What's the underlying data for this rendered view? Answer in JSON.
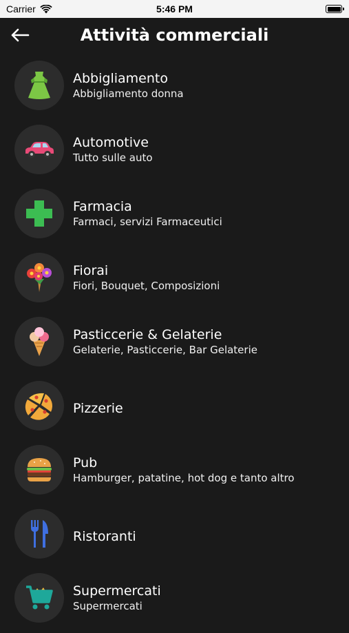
{
  "status": {
    "carrier": "Carrier",
    "time": "5:46 PM"
  },
  "header": {
    "title": "Attività commerciali"
  },
  "items": [
    {
      "name": "Abbigliamento",
      "subtitle": "Abbigliamento donna",
      "icon": "dress-icon"
    },
    {
      "name": "Automotive",
      "subtitle": "Tutto sulle auto",
      "icon": "car-icon"
    },
    {
      "name": "Farmacia",
      "subtitle": "Farmaci, servizi Farmaceutici",
      "icon": "pharmacy-cross-icon"
    },
    {
      "name": "Fiorai",
      "subtitle": "Fiori, Bouquet, Composizioni",
      "icon": "bouquet-icon"
    },
    {
      "name": "Pasticcerie & Gelaterie",
      "subtitle": "Gelaterie, Pasticcerie, Bar Gelaterie",
      "icon": "ice-cream-icon"
    },
    {
      "name": "Pizzerie",
      "subtitle": "",
      "icon": "pizza-icon"
    },
    {
      "name": "Pub",
      "subtitle": "Hamburger, patatine, hot dog e tanto altro",
      "icon": "burger-icon"
    },
    {
      "name": "Ristoranti",
      "subtitle": "",
      "icon": "fork-knife-icon"
    },
    {
      "name": "Supermercati",
      "subtitle": "Supermercati",
      "icon": "shopping-cart-icon"
    }
  ]
}
